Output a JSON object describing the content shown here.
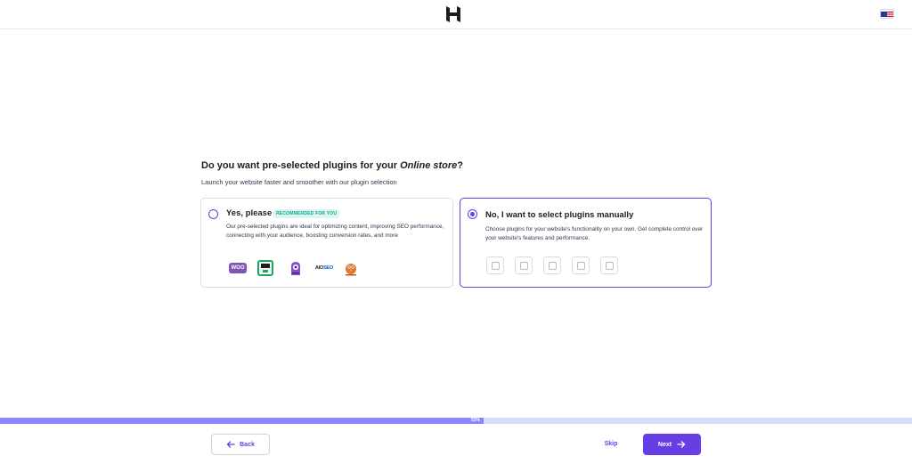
{
  "header": {
    "logo_icon": "hostinger-logo-icon",
    "language_icon": "us-flag-icon"
  },
  "question": {
    "title_prefix": "Do you want pre-selected plugins for your ",
    "title_emphasis": "Online store",
    "title_suffix": "?",
    "subtitle": "Launch your website faster and smoother with our plugin selection"
  },
  "options": {
    "yes": {
      "title": "Yes, please",
      "badge": "RECOMMENDED FOR YOU",
      "description": "Our pre-selected plugins are ideal for optimizing content, improving SEO performance, connecting with your audience, boosting conversion rates, and more",
      "selected": false,
      "plugins": [
        {
          "icon": "woocommerce-icon",
          "label": "WOO"
        },
        {
          "icon": "smash-balloon-icon"
        },
        {
          "icon": "monsterinsights-icon"
        },
        {
          "icon": "aioseo-icon",
          "label_a": "AIO",
          "label_b": "SEO"
        },
        {
          "icon": "wpforms-icon"
        }
      ]
    },
    "no": {
      "title": "No, I want to select plugins manually",
      "description": "Choose plugins for your website's functionality on your own. Get complete control over your website's features and performance.",
      "selected": true,
      "placeholder_count": 5
    }
  },
  "progress": {
    "value": 0.53,
    "label": "53%"
  },
  "footer": {
    "back_label": "Back",
    "skip_label": "Skip",
    "next_label": "Next"
  },
  "colors": {
    "accent": "#673de6",
    "progress_fill": "#8c85ff",
    "progress_track": "#d5dff8",
    "badge_bg": "#def4f0",
    "badge_text": "#00b090"
  }
}
